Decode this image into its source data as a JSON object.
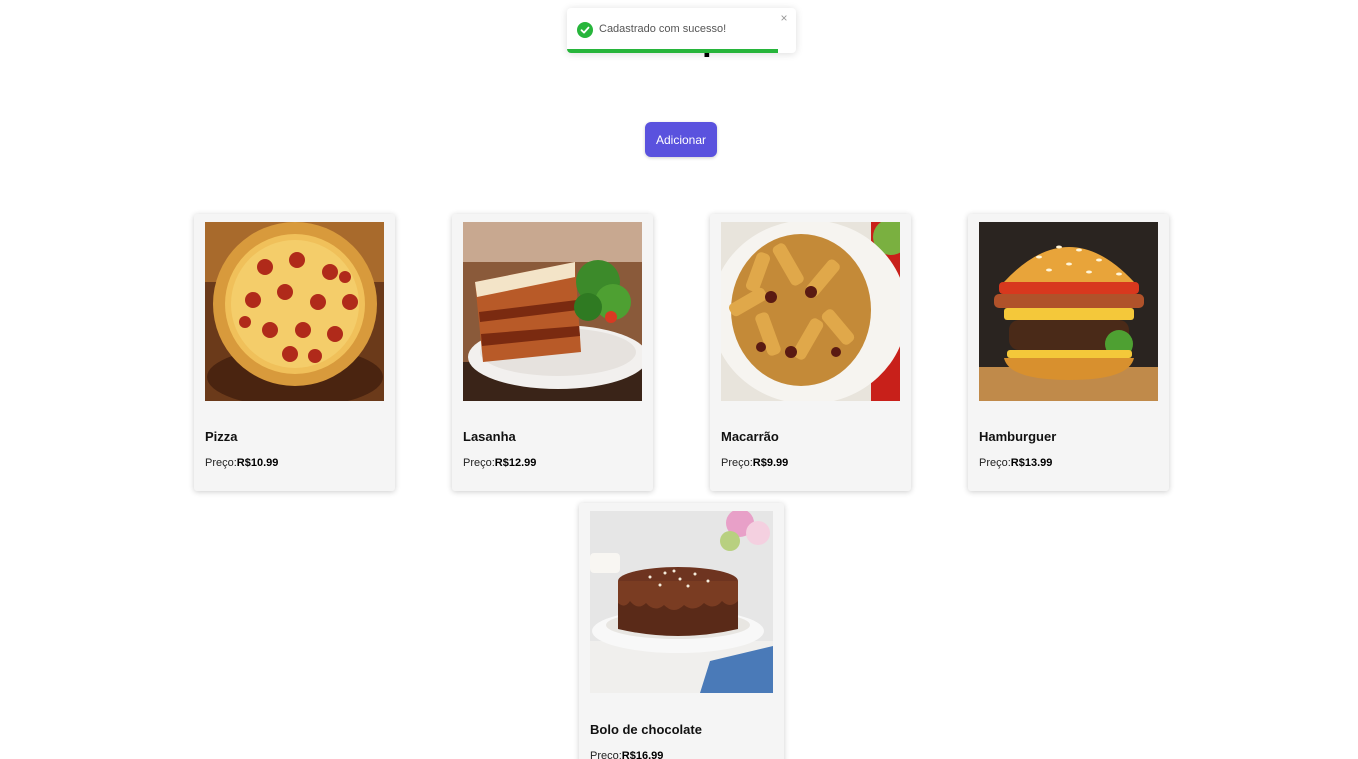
{
  "header": {
    "title": "Cardápio"
  },
  "toolbar": {
    "add_label": "Adicionar"
  },
  "toast": {
    "message": "Cadastrado com sucesso!",
    "close_symbol": "×",
    "status_color": "#27b53b",
    "progress_percent": 92
  },
  "labels": {
    "price_prefix": "Preço:"
  },
  "menu": {
    "items": [
      {
        "name": "Pizza",
        "price": "R$10.99",
        "image": "pizza-photo"
      },
      {
        "name": "Lasanha",
        "price": "R$12.99",
        "image": "lasagna-photo"
      },
      {
        "name": "Macarrão",
        "price": "R$9.99",
        "image": "pasta-photo"
      },
      {
        "name": "Hamburguer",
        "price": "R$13.99",
        "image": "burger-photo"
      },
      {
        "name": "Bolo de chocolate",
        "price": "R$16.99",
        "image": "chocolate-cake-photo"
      }
    ]
  },
  "colors": {
    "accent": "#5a52de",
    "card_bg": "#f5f5f5"
  }
}
